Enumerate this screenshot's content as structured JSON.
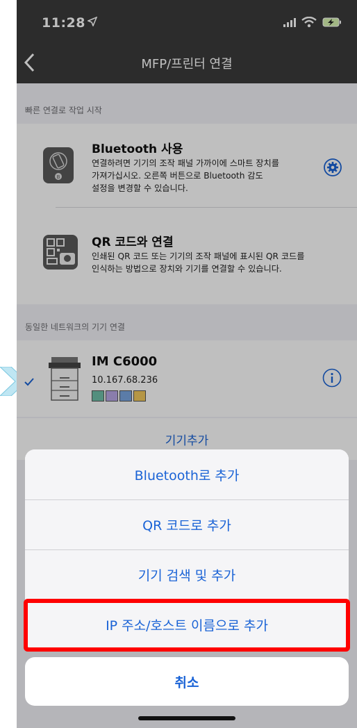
{
  "status": {
    "time": "11:28"
  },
  "nav": {
    "title": "MFP/프린터 연결"
  },
  "quick": {
    "header": "빠른 연결로 작업 시작",
    "bluetooth": {
      "title": "Bluetooth 사용",
      "desc": "연결하려면 기기의 조작 패널 가까이에 스마트 장치를\n가져가십시오. 오른쪽 버튼으로 Bluetooth 감도\n설정을 변경할 수 있습니다."
    },
    "qr": {
      "title": "QR 코드와 연결",
      "desc": "인쇄된 QR 코드 또는 기기의 조작 패널에 표시된 QR 코드를\n인식하는 방법으로 장치와 기기를 연결할 수 있습니다."
    }
  },
  "network": {
    "header": "동일한 네트워크의 기기 연결",
    "device": {
      "name": "IM C6000",
      "ip": "10.167.68.236"
    },
    "add_device": "기기추가"
  },
  "sheet": {
    "items": [
      {
        "label": "Bluetooth로 추가"
      },
      {
        "label": "QR 코드로 추가"
      },
      {
        "label": "기기 검색 및 추가"
      },
      {
        "label": "IP 주소/호스트 이름으로 추가",
        "highlighted": true
      }
    ],
    "cancel": "취소"
  },
  "colors": {
    "accent": "#1a63d6",
    "highlight": "#ff0000",
    "bar": "#3b3b3b"
  }
}
